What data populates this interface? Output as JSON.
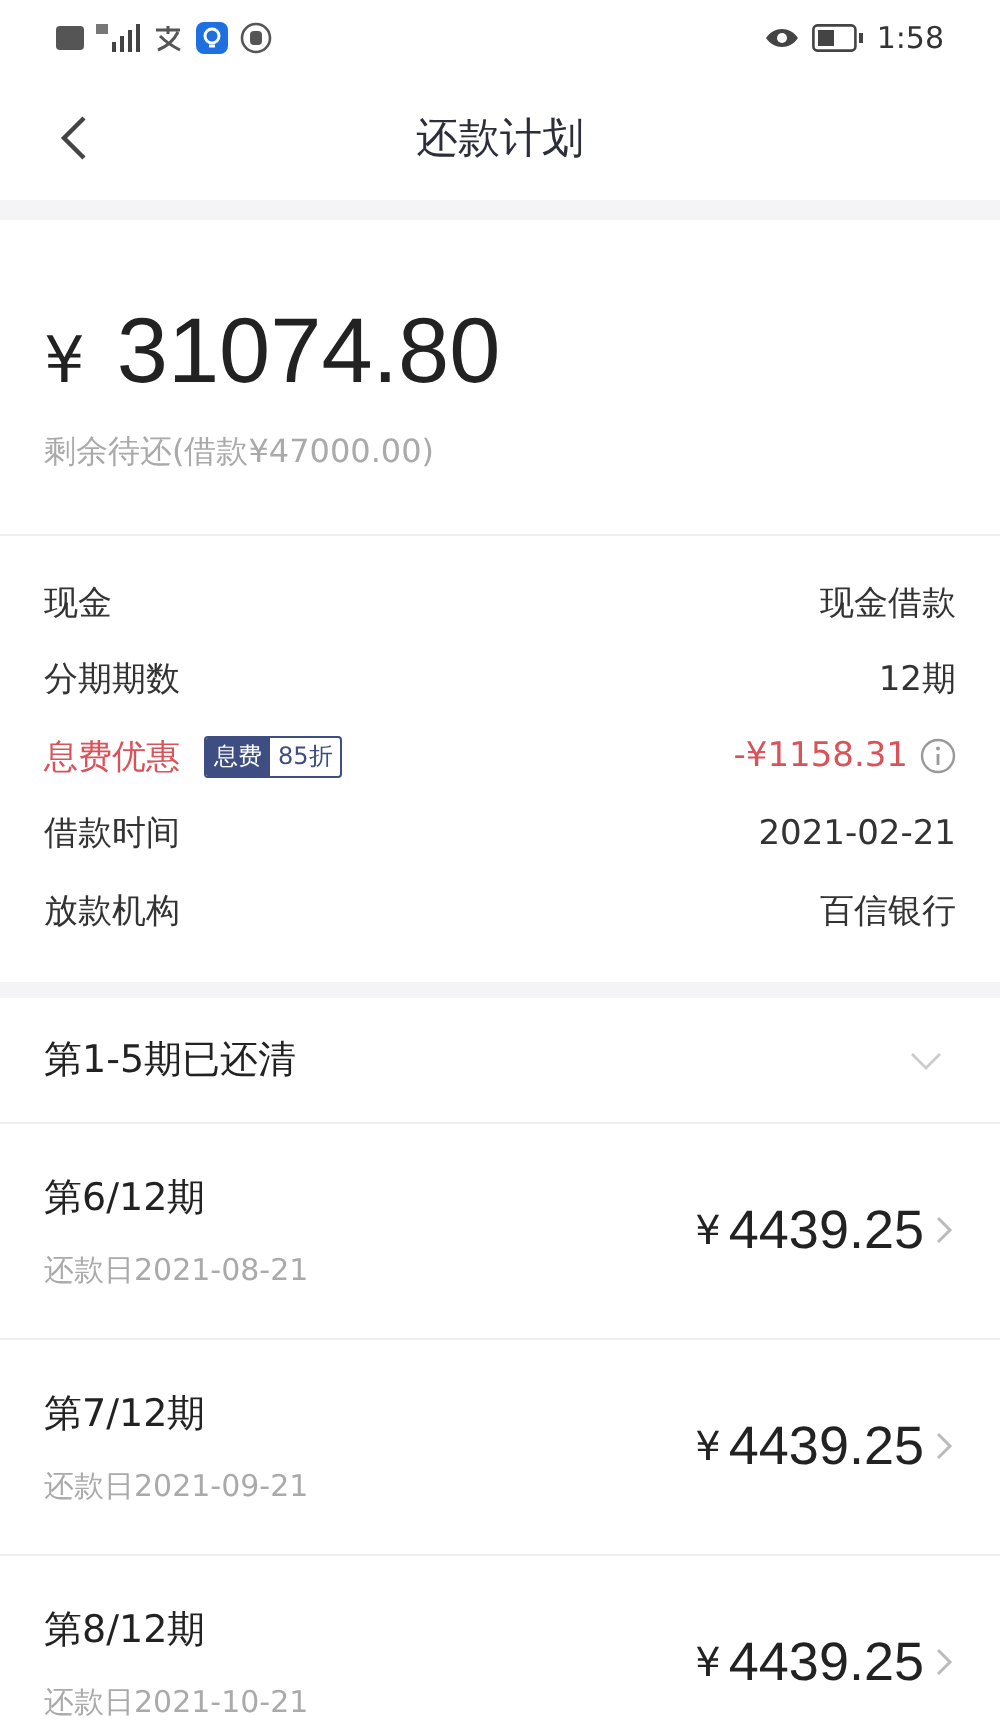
{
  "status_bar": {
    "time": "1:58"
  },
  "nav": {
    "title": "还款计划"
  },
  "summary": {
    "currency": "¥",
    "amount": "31074.80",
    "subtitle": "剩余待还(借款¥47000.00)"
  },
  "details": [
    {
      "kind": "plain",
      "label": "现金",
      "value": "现金借款"
    },
    {
      "kind": "plain",
      "label": "分期期数",
      "value": "12期"
    },
    {
      "kind": "discount",
      "label": "息费优惠",
      "tag": "息费",
      "tag_value": "85折",
      "value": "-¥1158.31"
    },
    {
      "kind": "plain",
      "label": "借款时间",
      "value": "2021-02-21"
    },
    {
      "kind": "plain",
      "label": "放款机构",
      "value": "百信银行"
    }
  ],
  "paid_group": {
    "label": "第1-5期已还清",
    "expanded": false
  },
  "installments": [
    {
      "title": "第6/12期",
      "due": "还款日2021-08-21",
      "currency": "¥",
      "amount": "4439.25"
    },
    {
      "title": "第7/12期",
      "due": "还款日2021-09-21",
      "currency": "¥",
      "amount": "4439.25"
    },
    {
      "title": "第8/12期",
      "due": "还款日2021-10-21",
      "currency": "¥",
      "amount": "4439.25"
    }
  ]
}
